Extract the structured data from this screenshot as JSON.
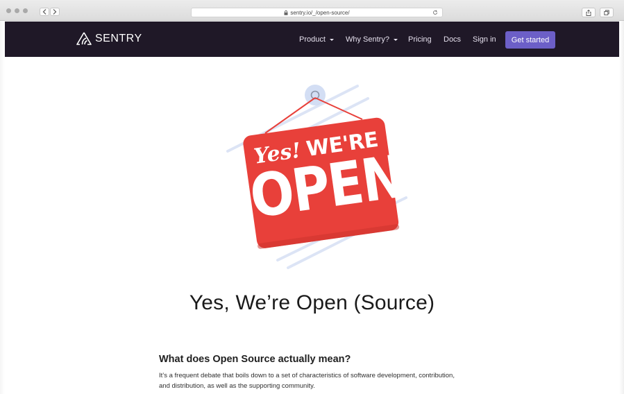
{
  "browser": {
    "url": "sentry.io/_/open-source/",
    "icons": [
      "back-icon",
      "forward-icon",
      "lock-icon",
      "reload-icon",
      "share-icon",
      "tabs-icon"
    ]
  },
  "navbar": {
    "logo_text": "SENTRY",
    "items": [
      {
        "label": "Product",
        "has_dropdown": true
      },
      {
        "label": "Why Sentry?",
        "has_dropdown": true
      },
      {
        "label": "Pricing",
        "has_dropdown": false
      },
      {
        "label": "Docs",
        "has_dropdown": false
      },
      {
        "label": "Sign in",
        "has_dropdown": false
      }
    ],
    "cta_label": "Get started"
  },
  "hero": {
    "sign_line1_script": "Yes!",
    "sign_line1_caps": "WE'RE",
    "sign_line2": "OPEN"
  },
  "main": {
    "headline": "Yes, We’re Open (Source)",
    "subheading": "What does Open Source actually mean?",
    "paragraph": "It’s a frequent debate that boils down to a set of characteristics of software development, contribution, and distribution, as well as the supporting community."
  },
  "colors": {
    "navbar_bg": "#1f1827",
    "cta_bg": "#6c5fc7",
    "sign_red": "#e8403a",
    "sign_text": "#ffffff"
  }
}
